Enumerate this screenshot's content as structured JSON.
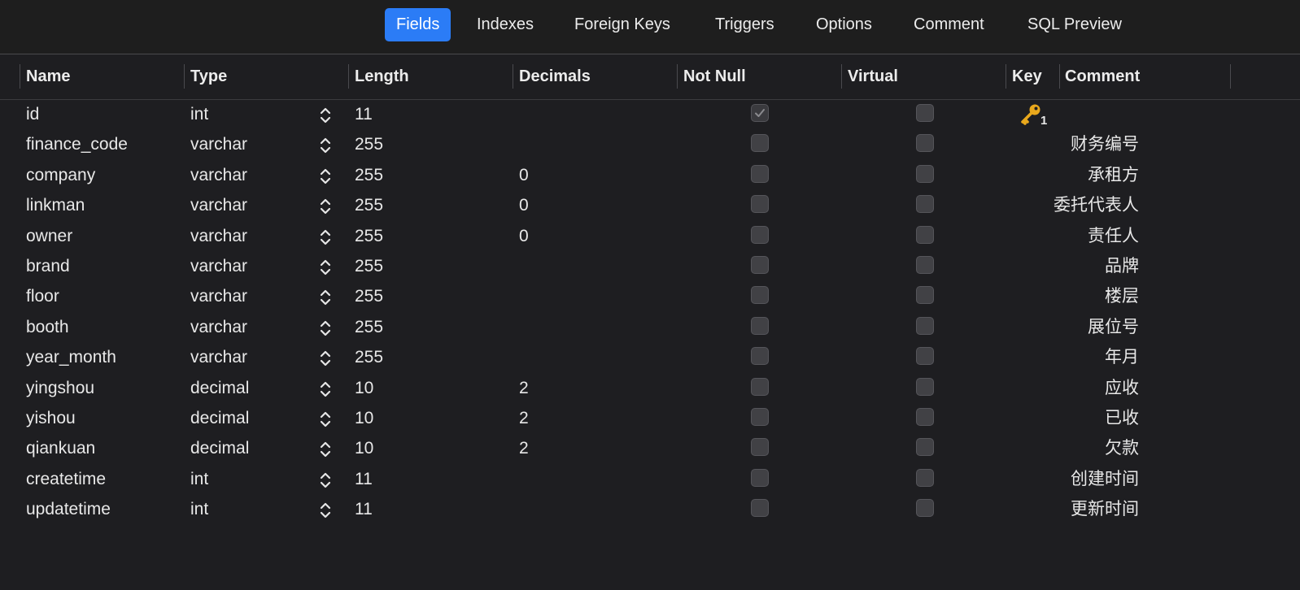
{
  "tabs": [
    {
      "label": "Fields",
      "active": true
    },
    {
      "label": "Indexes",
      "active": false
    },
    {
      "label": "Foreign Keys",
      "active": false
    },
    {
      "label": "Triggers",
      "active": false
    },
    {
      "label": "Options",
      "active": false
    },
    {
      "label": "Comment",
      "active": false
    },
    {
      "label": "SQL Preview",
      "active": false
    }
  ],
  "columns": {
    "name": "Name",
    "type": "Type",
    "length": "Length",
    "decimals": "Decimals",
    "not_null": "Not Null",
    "virtual": "Virtual",
    "key": "Key",
    "comment": "Comment"
  },
  "fields": [
    {
      "name": "id",
      "type": "int",
      "length": "11",
      "decimals": "",
      "not_null": true,
      "virtual": false,
      "key": "1",
      "comment": ""
    },
    {
      "name": "finance_code",
      "type": "varchar",
      "length": "255",
      "decimals": "",
      "not_null": false,
      "virtual": false,
      "key": "",
      "comment": "财务编号"
    },
    {
      "name": "company",
      "type": "varchar",
      "length": "255",
      "decimals": "0",
      "not_null": false,
      "virtual": false,
      "key": "",
      "comment": "承租方"
    },
    {
      "name": "linkman",
      "type": "varchar",
      "length": "255",
      "decimals": "0",
      "not_null": false,
      "virtual": false,
      "key": "",
      "comment": "委托代表人"
    },
    {
      "name": "owner",
      "type": "varchar",
      "length": "255",
      "decimals": "0",
      "not_null": false,
      "virtual": false,
      "key": "",
      "comment": "责任人"
    },
    {
      "name": "brand",
      "type": "varchar",
      "length": "255",
      "decimals": "",
      "not_null": false,
      "virtual": false,
      "key": "",
      "comment": "品牌"
    },
    {
      "name": "floor",
      "type": "varchar",
      "length": "255",
      "decimals": "",
      "not_null": false,
      "virtual": false,
      "key": "",
      "comment": "楼层"
    },
    {
      "name": "booth",
      "type": "varchar",
      "length": "255",
      "decimals": "",
      "not_null": false,
      "virtual": false,
      "key": "",
      "comment": "展位号"
    },
    {
      "name": "year_month",
      "type": "varchar",
      "length": "255",
      "decimals": "",
      "not_null": false,
      "virtual": false,
      "key": "",
      "comment": "年月"
    },
    {
      "name": "yingshou",
      "type": "decimal",
      "length": "10",
      "decimals": "2",
      "not_null": false,
      "virtual": false,
      "key": "",
      "comment": "应收"
    },
    {
      "name": "yishou",
      "type": "decimal",
      "length": "10",
      "decimals": "2",
      "not_null": false,
      "virtual": false,
      "key": "",
      "comment": "已收"
    },
    {
      "name": "qiankuan",
      "type": "decimal",
      "length": "10",
      "decimals": "2",
      "not_null": false,
      "virtual": false,
      "key": "",
      "comment": "欠款"
    },
    {
      "name": "createtime",
      "type": "int",
      "length": "11",
      "decimals": "",
      "not_null": false,
      "virtual": false,
      "key": "",
      "comment": "创建时间"
    },
    {
      "name": "updatetime",
      "type": "int",
      "length": "11",
      "decimals": "",
      "not_null": false,
      "virtual": false,
      "key": "",
      "comment": "更新时间"
    }
  ],
  "colors": {
    "accent": "#2b7cf6",
    "background": "#1e1e21",
    "key_icon": "#e9a81c"
  },
  "icons": {
    "stepper": "up-down-chevron-icon",
    "key": "key-icon",
    "check": "checkmark-icon"
  }
}
